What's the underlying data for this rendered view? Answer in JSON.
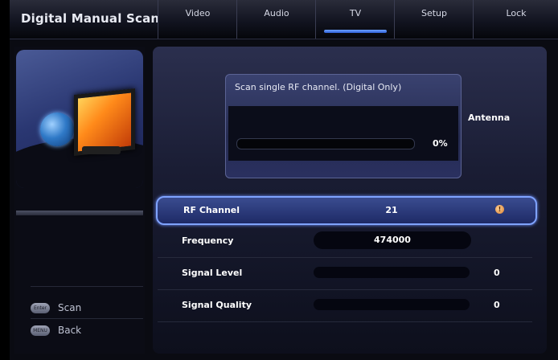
{
  "header": {
    "title": "Digital Manual Scan",
    "tabs": [
      {
        "label": "Video",
        "active": false
      },
      {
        "label": "Audio",
        "active": false
      },
      {
        "label": "TV",
        "active": true
      },
      {
        "label": "Setup",
        "active": false
      },
      {
        "label": "Lock",
        "active": false
      }
    ]
  },
  "dialog": {
    "message": "Scan single RF channel. (Digital Only)",
    "progress_percent": 0,
    "progress_label": "0%",
    "source_label": "Antenna"
  },
  "settings": {
    "rows": [
      {
        "label": "RF Channel",
        "value": "21",
        "selected": true
      },
      {
        "label": "Frequency",
        "value": "474000"
      },
      {
        "label": "Signal Level",
        "value": "0",
        "level_fraction": 0
      },
      {
        "label": "Signal Quality",
        "value": "0",
        "level_fraction": 0
      }
    ]
  },
  "hints": [
    {
      "button": "Enter",
      "label": "Scan"
    },
    {
      "button": "MENU",
      "label": "Back"
    }
  ],
  "icons": {
    "illustration": "globe-and-tv-icon",
    "rf_channel_indicator": "info-icon"
  },
  "colors": {
    "accent": "#7fa3ff",
    "tab_active_indicator": "#4a7bdc"
  }
}
